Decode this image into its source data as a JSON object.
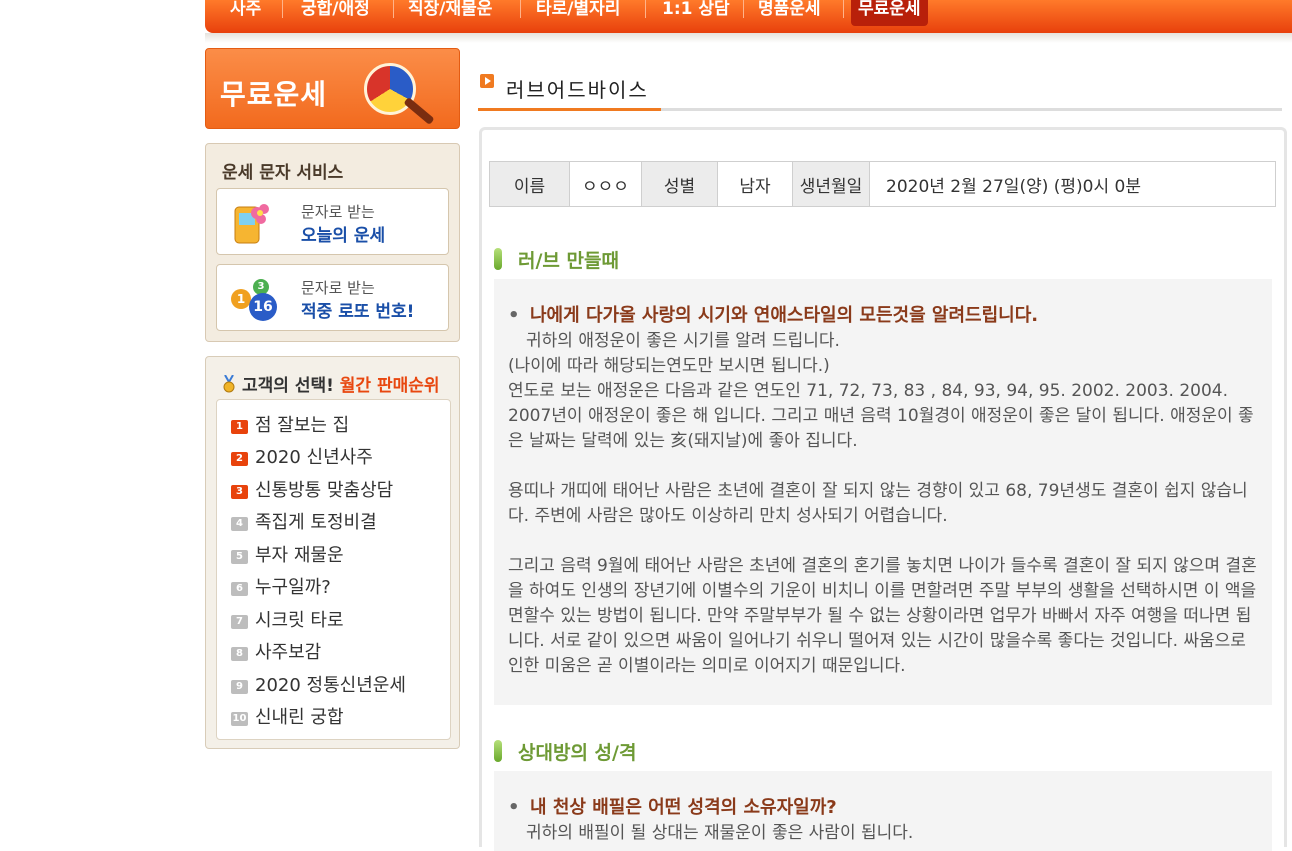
{
  "nav": {
    "items": [
      "사주",
      "궁합/애정",
      "직장/재물운",
      "타로/별자리",
      "1:1 상담",
      "명품운세",
      "무료운세"
    ],
    "active": "무료운세"
  },
  "sidebar": {
    "free_banner": "무료운세",
    "sms": {
      "title": "운세 문자 서비스",
      "card1_small": "문자로 받는",
      "card1_big": "오늘의 운세",
      "card2_small": "문자로 받는",
      "card2_big": "적중 로또 번호!",
      "lotto_balls": [
        "1",
        "3",
        "16"
      ]
    },
    "ranking": {
      "title_prefix": "고객의 선택!",
      "title_highlight": "월간 판매순위",
      "items": [
        {
          "num": "1",
          "label": "점 잘보는 집"
        },
        {
          "num": "2",
          "label": "2020 신년사주"
        },
        {
          "num": "3",
          "label": "신통방통 맞춤상담"
        },
        {
          "num": "4",
          "label": "족집게 토정비결"
        },
        {
          "num": "5",
          "label": "부자 재물운"
        },
        {
          "num": "6",
          "label": "누구일까?"
        },
        {
          "num": "7",
          "label": "시크릿 타로"
        },
        {
          "num": "8",
          "label": "사주보감"
        },
        {
          "num": "9",
          "label": "2020 정통신년운세"
        },
        {
          "num": "10",
          "label": "신내린 궁합"
        }
      ]
    }
  },
  "main": {
    "page_title": "러브어드바이스",
    "info": {
      "name_label": "이름",
      "name_value": "ㅇㅇㅇ",
      "gender_label": "성별",
      "gender_value": "남자",
      "birth_label": "생년월일",
      "birth_value": "2020년 2월 27일(양) (평)0시 0분"
    },
    "sections": [
      {
        "title": "러/브 만들때",
        "headline": "나에게 다가올 사랑의 시기와 연애스타일의 모든것을 알려드립니다.",
        "lead": "귀하의 애정운이 좋은 시기를 알려 드립니다.",
        "paragraphs": [
          "(나이에 따라 해당되는연도만 보시면 됩니다.)",
          "연도로 보는 애정운은 다음과 같은 연도인 71, 72, 73, 83 , 84, 93, 94, 95. 2002. 2003. 2004. 2007년이 애정운이 좋은 해 입니다. 그리고 매년 음력 10월경이 애정운이 좋은 달이 됩니다. 애정운이 좋은 날짜는 달력에 있는 亥(돼지날)에 좋아 집니다.",
          "용띠나 개띠에 태어난 사람은 초년에 결혼이 잘 되지 않는 경향이 있고 68, 79년생도 결혼이 쉽지 않습니다. 주변에 사람은 많아도 이상하리 만치 성사되기 어렵습니다.",
          "그리고 음력 9월에 태어난 사람은 초년에 결혼의 혼기를 놓치면 나이가 들수록 결혼이 잘 되지 않으며 결혼을 하여도 인생의 장년기에 이별수의 기운이 비치니 이를 면할려면 주말 부부의 생활을 선택하시면 이 액을 면할수 있는 방법이 됩니다. 만약 주말부부가 될 수 없는 상황이라면 업무가 바빠서 자주 여행을 떠나면 됩니다. 서로 같이 있으면 싸움이 일어나기 쉬우니 떨어져 있는 시간이 많을수록 좋다는 것입니다. 싸움으로 인한 미움은 곧 이별이라는 의미로 이어지기 때문입니다."
        ]
      },
      {
        "title": "상대방의 성/격",
        "headline": "내 천상 배필은 어떤 성격의 소유자일까?",
        "lead": "귀하의 배필이 될 상대는 재물운이 좋은 사람이 됩니다."
      }
    ]
  },
  "colors": {
    "nav_orange": "#e8400c",
    "accent_orange": "#f07a20",
    "section_green": "#6e9a35",
    "headline_brown": "#8a3a1a",
    "rank_red": "#e8430c"
  }
}
